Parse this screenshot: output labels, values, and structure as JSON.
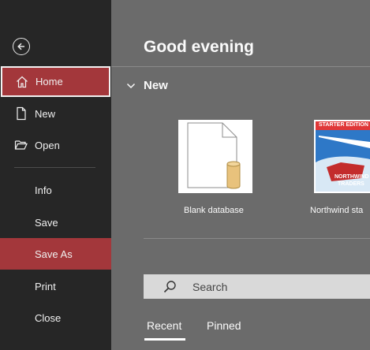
{
  "sidebar": {
    "back_icon": "back-arrow-icon",
    "items": [
      {
        "label": "Home",
        "icon": "home-icon"
      },
      {
        "label": "New",
        "icon": "new-document-icon"
      },
      {
        "label": "Open",
        "icon": "open-folder-icon"
      },
      {
        "label": "Info"
      },
      {
        "label": "Save"
      },
      {
        "label": "Save As"
      },
      {
        "label": "Print"
      },
      {
        "label": "Close"
      }
    ],
    "selected_item": "Home",
    "highlighted_item": "Save As"
  },
  "main": {
    "greeting": "Good evening",
    "new_section": {
      "title": "New",
      "templates": [
        {
          "label": "Blank database"
        },
        {
          "label": "Northwind sta",
          "badge": "STARTER EDITION",
          "logo_line1": "NORTHWIND",
          "logo_line2": "TRADERS"
        }
      ]
    },
    "search": {
      "placeholder": "Search"
    },
    "tabs": [
      {
        "label": "Recent",
        "selected": true
      },
      {
        "label": "Pinned",
        "selected": false
      }
    ]
  },
  "colors": {
    "accent": "#a3373b",
    "sidebar_bg": "#262626",
    "main_bg": "#6b6b6b"
  }
}
